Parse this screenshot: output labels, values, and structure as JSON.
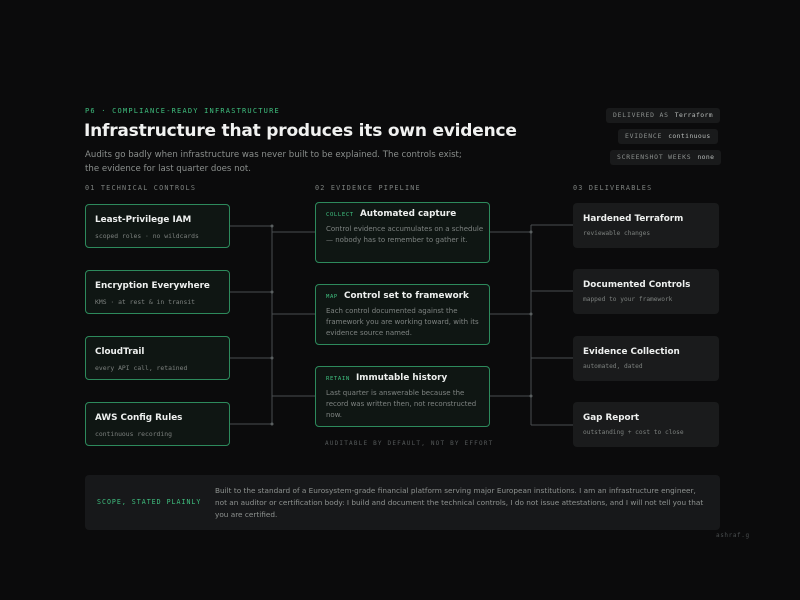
{
  "header": {
    "eyebrow": "P6 · COMPLIANCE-READY INFRASTRUCTURE",
    "title": "Infrastructure that produces its own evidence",
    "subtitle": "Audits go badly when infrastructure was never built to be explained. The controls exist; the evidence for last quarter does not."
  },
  "badges": [
    {
      "label": "DELIVERED AS",
      "value": "Terraform"
    },
    {
      "label": "EVIDENCE",
      "value": "continuous"
    },
    {
      "label": "SCREENSHOT WEEKS",
      "value": "none"
    }
  ],
  "columns": {
    "controls": "01  TECHNICAL CONTROLS",
    "pipeline": "02  EVIDENCE PIPELINE",
    "deliverables": "03  DELIVERABLES"
  },
  "controls": [
    {
      "title": "Least-Privilege IAM",
      "sub": "scoped roles · no wildcards"
    },
    {
      "title": "Encryption Everywhere",
      "sub": "KMS · at rest & in transit"
    },
    {
      "title": "CloudTrail",
      "sub": "every API call, retained"
    },
    {
      "title": "AWS Config Rules",
      "sub": "continuous recording"
    }
  ],
  "pipeline": [
    {
      "tag": "COLLECT",
      "title": "Automated capture",
      "desc": "Control evidence accumulates on a schedule — nobody has to remember to gather it."
    },
    {
      "tag": "MAP",
      "title": "Control set to framework",
      "desc": "Each control documented against the framework you are working toward, with its evidence source named."
    },
    {
      "tag": "RETAIN",
      "title": "Immutable history",
      "desc": "Last quarter is answerable because the record was written then, not reconstructed now."
    }
  ],
  "pipeline_note": "AUDITABLE BY DEFAULT, NOT BY EFFORT",
  "deliverables": [
    {
      "title": "Hardened Terraform",
      "sub": "reviewable changes"
    },
    {
      "title": "Documented Controls",
      "sub": "mapped to your framework"
    },
    {
      "title": "Evidence Collection",
      "sub": "automated, dated"
    },
    {
      "title": "Gap Report",
      "sub": "outstanding + cost to close"
    }
  ],
  "scope": {
    "label": "SCOPE, STATED PLAINLY",
    "text": "Built to the standard of a Eurosystem-grade financial platform serving major European institutions. I am an infrastructure engineer, not an auditor or certification body: I build and document the technical controls, I do not issue attestations, and I will not tell you that you are certified."
  },
  "signature": "ashraf.g",
  "colors": {
    "accent": "#3fbf7f",
    "card_border": "#2d8a5c",
    "connector": "#4a4e50",
    "background": "#0b0b0c"
  }
}
